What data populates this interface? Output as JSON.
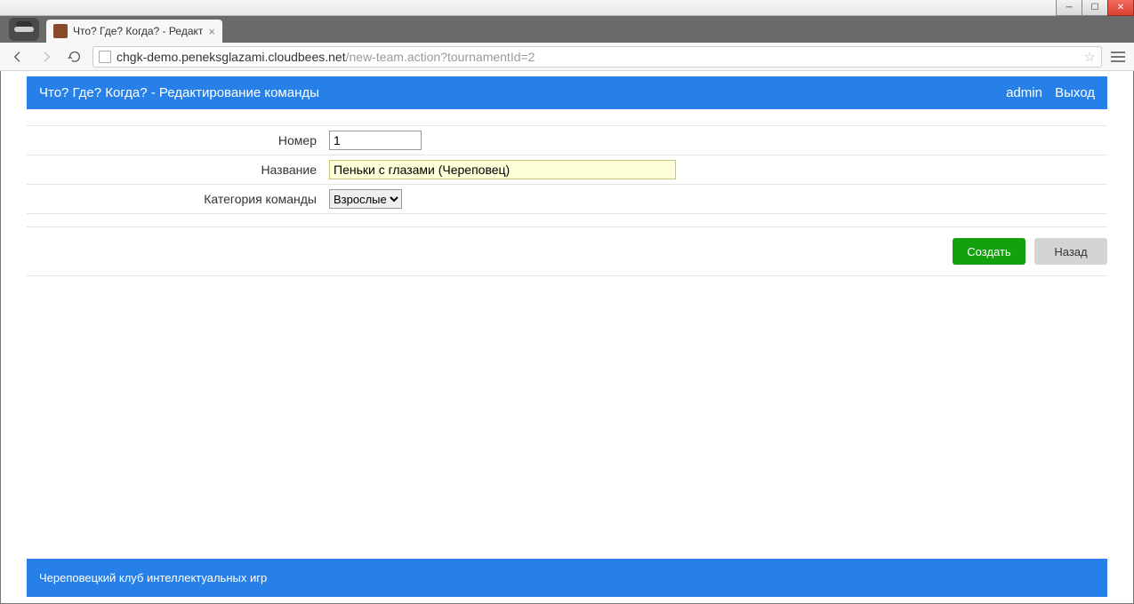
{
  "browser": {
    "tab_title": "Что? Где? Когда? - Редакт",
    "url_host": "chgk-demo.peneksglazami.cloudbees.net",
    "url_path": "/new-team.action?tournamentId=2"
  },
  "header": {
    "title": "Что? Где? Когда? - Редактирование команды",
    "user": "admin",
    "logout": "Выход"
  },
  "form": {
    "number_label": "Номер",
    "number_value": "1",
    "name_label": "Название",
    "name_value": "Пеньки с глазами (Череповец)",
    "category_label": "Категория команды",
    "category_selected": "Взрослые"
  },
  "buttons": {
    "create": "Создать",
    "back": "Назад"
  },
  "footer": {
    "text": "Череповецкий клуб интеллектуальных игр"
  }
}
